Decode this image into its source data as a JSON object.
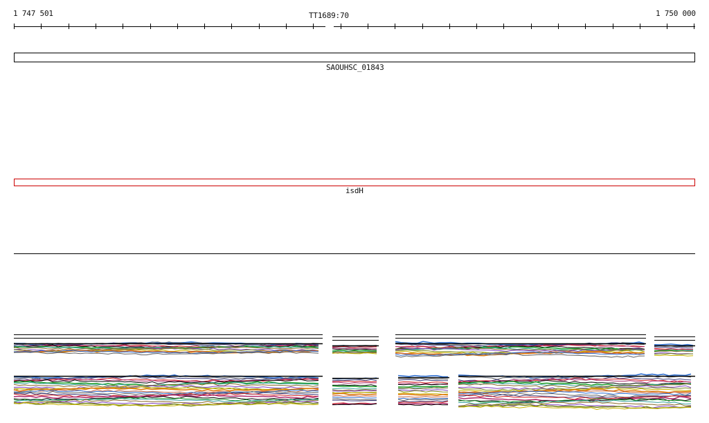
{
  "ruler": {
    "start_label": "1 747 501",
    "center_label": "TT1689:70",
    "end_label": "1 750 000"
  },
  "features": [
    {
      "label": "SAOUHSC_01843",
      "color": "#000000"
    },
    {
      "label": "isdH",
      "color": "#cc0000"
    }
  ],
  "tracks": {
    "line_colors": [
      "#000000",
      "#8a6a2a",
      "#c8b400",
      "#2f6fd0",
      "#d02020",
      "#20a030",
      "#8040c0",
      "#e07a10",
      "#606060",
      "#b03070",
      "#3aa0a0",
      "#7a8a20",
      "#c06040",
      "#404080"
    ]
  }
}
